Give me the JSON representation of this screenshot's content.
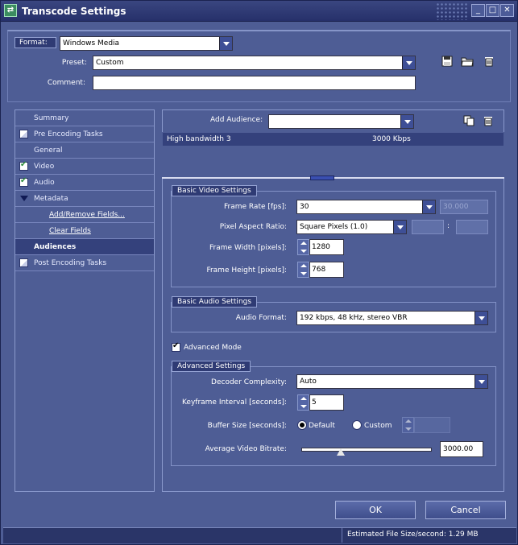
{
  "window": {
    "title": "Transcode Settings",
    "app_icon": "transcode-app-icon",
    "controls": {
      "minimize": "_",
      "maximize": "□",
      "close": "✕"
    }
  },
  "header": {
    "format_label": "Format:",
    "format_value": "Windows Media",
    "preset_label": "Preset:",
    "preset_value": "Custom",
    "comment_label": "Comment:",
    "comment_value": "",
    "icons": [
      "save-icon",
      "open-folder-icon",
      "delete-icon"
    ]
  },
  "sidebar": {
    "items": [
      {
        "label": "Summary",
        "check": "none",
        "link": false
      },
      {
        "label": "Pre Encoding Tasks",
        "check": "partial",
        "link": false
      },
      {
        "label": "General",
        "check": "none",
        "link": false
      },
      {
        "label": "Video",
        "check": "checked",
        "link": false
      },
      {
        "label": "Audio",
        "check": "checked",
        "link": false
      },
      {
        "label": "Metadata",
        "check": "expand",
        "link": false
      },
      {
        "label": "Add/Remove Fields...",
        "check": "none",
        "link": true
      },
      {
        "label": "Clear Fields",
        "check": "none",
        "link": true
      },
      {
        "label": "Audiences",
        "check": "none",
        "link": false,
        "selected": true
      },
      {
        "label": "Post Encoding Tasks",
        "check": "partial",
        "link": false
      }
    ]
  },
  "audience": {
    "add_label": "Add Audience:",
    "add_value": "",
    "icons": [
      "copy-icon",
      "delete-icon"
    ],
    "rows": [
      {
        "name": "High bandwidth 3",
        "bitrate": "3000 Kbps"
      }
    ]
  },
  "video": {
    "group_title": "Basic Video Settings",
    "frame_rate_label": "Frame Rate [fps]:",
    "frame_rate_value": "30",
    "frame_rate_custom": "30.000",
    "pixel_aspect_label": "Pixel Aspect Ratio:",
    "pixel_aspect_value": "Square Pixels (1.0)",
    "pixel_aspect_sep": ":",
    "frame_width_label": "Frame Width [pixels]:",
    "frame_width_value": "1280",
    "frame_height_label": "Frame Height [pixels]:",
    "frame_height_value": "768"
  },
  "audio": {
    "group_title": "Basic Audio Settings",
    "format_label": "Audio Format:",
    "format_value": "192 kbps, 48 kHz, stereo VBR"
  },
  "advanced_mode": {
    "label": "Advanced Mode",
    "checked": true
  },
  "advanced": {
    "group_title": "Advanced Settings",
    "decoder_label": "Decoder Complexity:",
    "decoder_value": "Auto",
    "keyframe_label": "Keyframe Interval [seconds]:",
    "keyframe_value": "5",
    "buffer_label": "Buffer Size [seconds]:",
    "buffer_default": "Default",
    "buffer_custom": "Custom",
    "buffer_selected": "Default",
    "buffer_custom_value": "",
    "bitrate_label": "Average Video Bitrate:",
    "bitrate_value": "3000.00",
    "bitrate_slider_fraction": 0.3
  },
  "footer": {
    "ok": "OK",
    "cancel": "Cancel"
  },
  "status": {
    "text": "Estimated File Size/second: 1.29 MB"
  }
}
